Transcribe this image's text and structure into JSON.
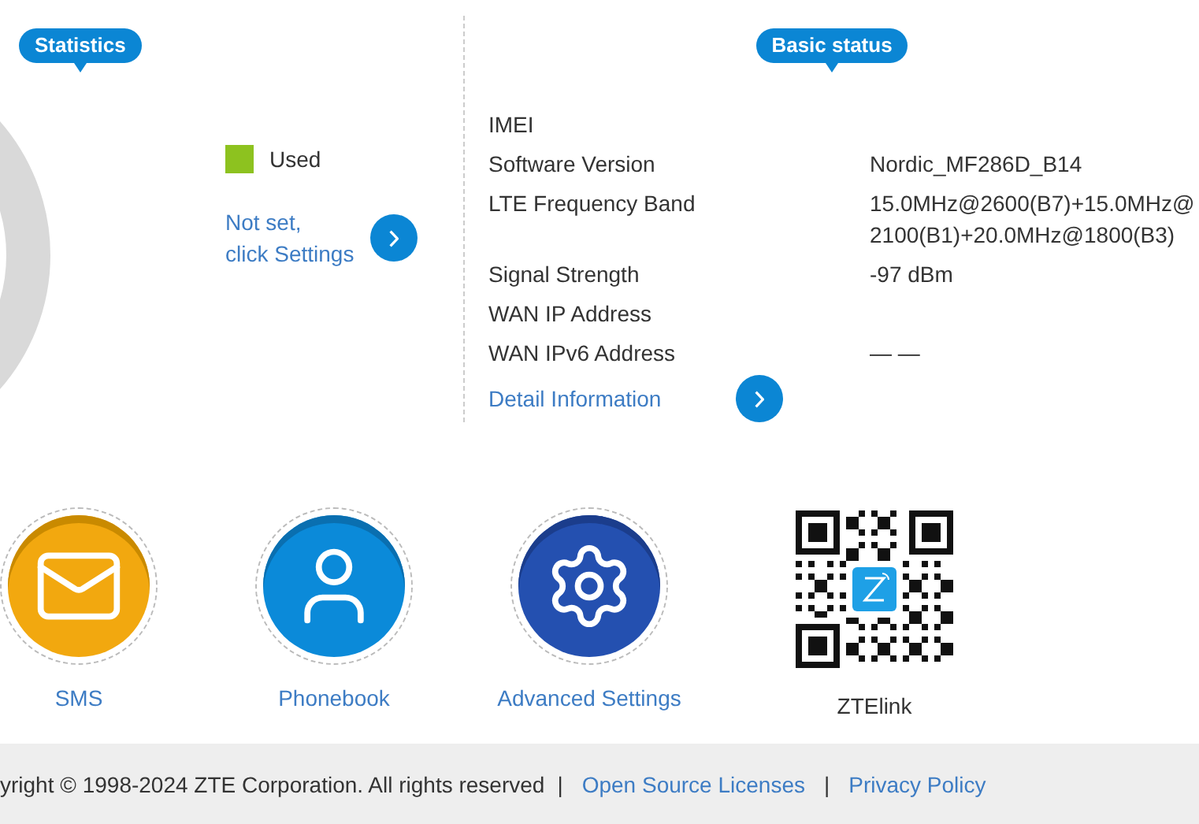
{
  "statistics": {
    "title": "Statistics",
    "legend": [
      {
        "label": "Used"
      }
    ],
    "settings_link": [
      "Not set,",
      "click Settings"
    ]
  },
  "basic_status": {
    "title": "Basic status",
    "rows": [
      {
        "label": "IMEI"
      },
      {
        "label": "Software Version",
        "value": "Nordic_MF286D_B14"
      },
      {
        "label": "LTE Frequency Band",
        "value": "15.0MHz@2600(B7)+15.0MHz@2100(B1)+20.0MHz@1800(B3)"
      },
      {
        "label": "Signal Strength",
        "value": "-97 dBm"
      },
      {
        "label": "WAN IP Address"
      },
      {
        "label": "WAN IPv6 Address",
        "value": "— —"
      }
    ],
    "detail_link": "Detail Information"
  },
  "shortcuts": [
    {
      "kind": "sms",
      "label": "SMS"
    },
    {
      "kind": "phonebook",
      "label": "Phonebook"
    },
    {
      "kind": "settings",
      "label": "Advanced Settings"
    },
    {
      "kind": "qr",
      "label": "ZTElink"
    }
  ],
  "footer": [
    {
      "kind": "text",
      "text": "yright © 1998-2024 ZTE Corporation. All rights reserved"
    },
    {
      "kind": "separator",
      "text": "|"
    },
    {
      "kind": "link",
      "text": "Open Source Licenses"
    },
    {
      "kind": "separator",
      "text": "|"
    },
    {
      "kind": "link",
      "text": "Privacy Policy"
    }
  ]
}
